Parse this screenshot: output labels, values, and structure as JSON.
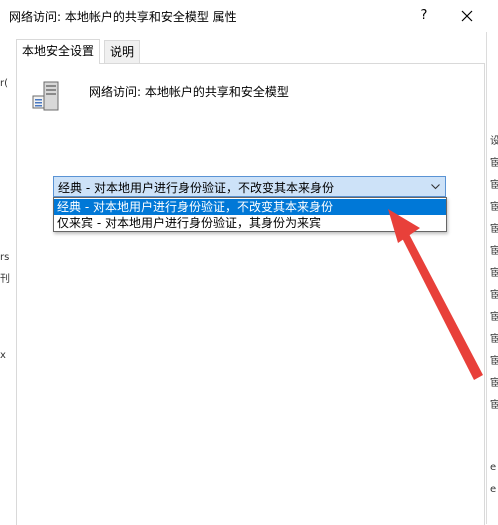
{
  "window": {
    "title": "网络访问: 本地帐户的共享和安全模型 属性",
    "help_label": "?",
    "close_icon": "close-icon"
  },
  "tabs": [
    {
      "label": "本地安全设置",
      "active": true
    },
    {
      "label": "说明",
      "active": false
    }
  ],
  "policy": {
    "icon": "server-icon",
    "name": "网络访问: 本地帐户的共享和安全模型"
  },
  "combo": {
    "selected": "经典 - 对本地用户进行身份验证，不改变其本来身份",
    "options": [
      "经典 - 对本地用户进行身份验证，不改变其本来身份",
      "仅来宾 - 对本地用户进行身份验证，其身份为来宾"
    ],
    "highlighted_index": 0
  },
  "annotation": {
    "color": "#e8403a"
  },
  "background_fragments": {
    "left": [
      "r(",
      "rs",
      "刊",
      "x"
    ],
    "right": [
      "设",
      "宦",
      "宦",
      "宦",
      "宦",
      "宦",
      "宦",
      "宦",
      "宦",
      "宦",
      "宦",
      "宦",
      "宦",
      "e",
      "e"
    ]
  }
}
